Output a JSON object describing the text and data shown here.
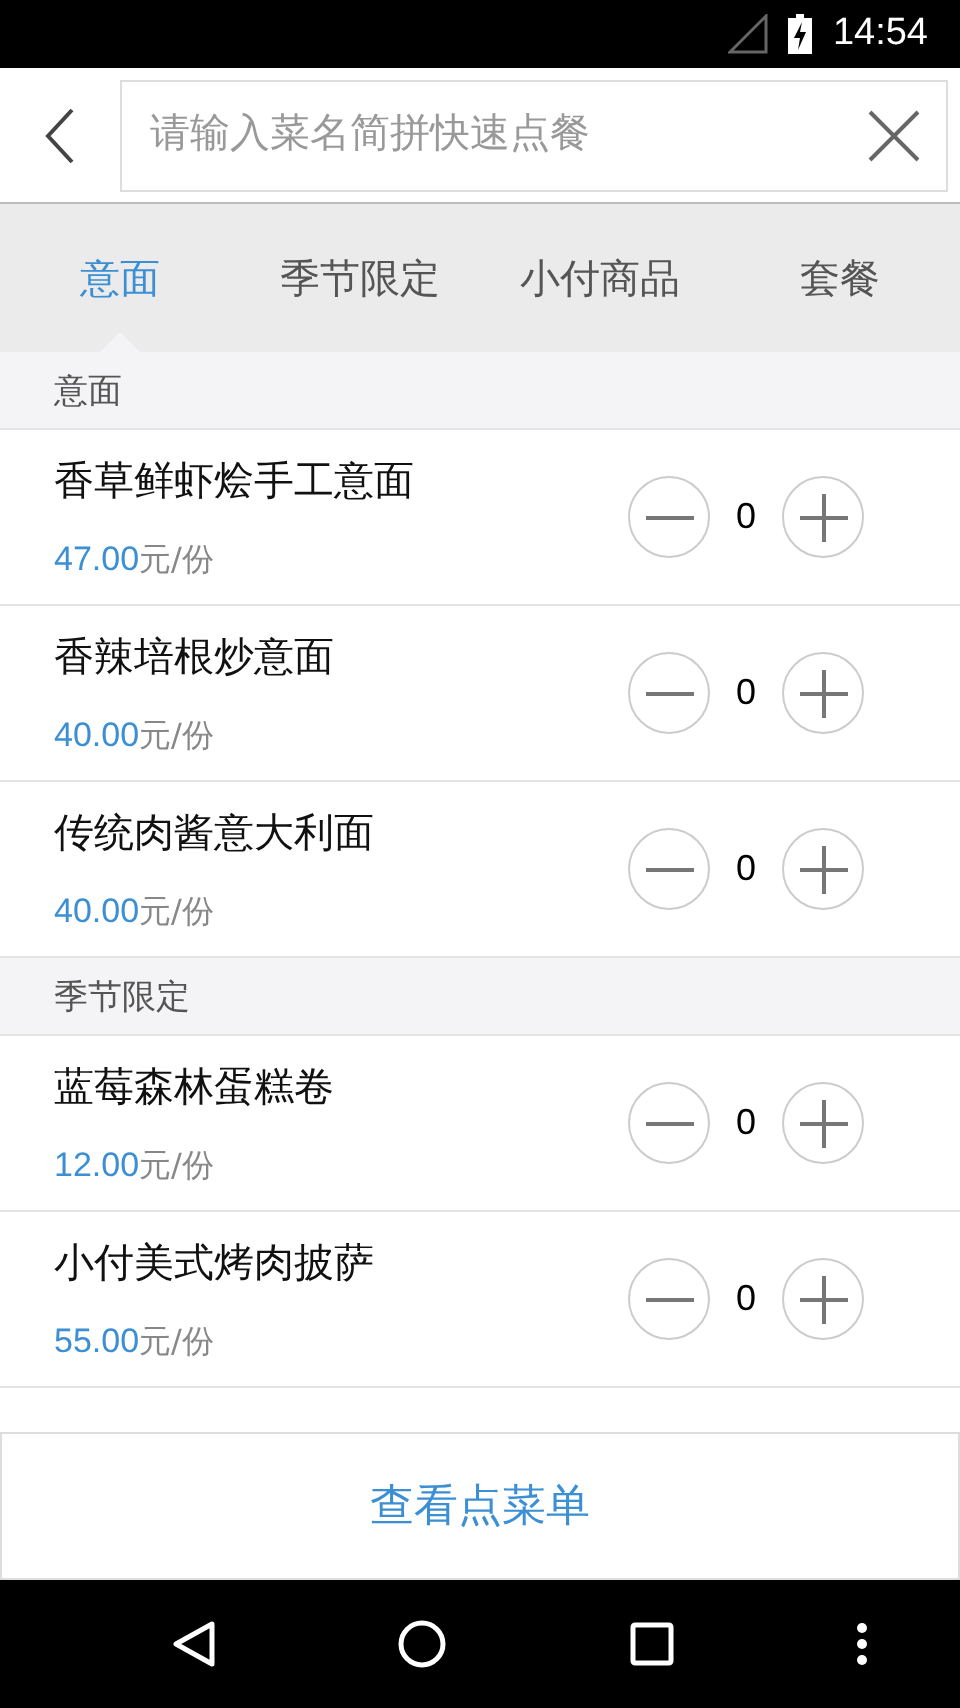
{
  "status_bar": {
    "time": "14:54"
  },
  "search": {
    "placeholder": "请输入菜名简拼快速点餐"
  },
  "tabs": [
    {
      "label": "意面",
      "selected": true
    },
    {
      "label": "季节限定",
      "selected": false
    },
    {
      "label": "小付商品",
      "selected": false
    },
    {
      "label": "套餐",
      "selected": false
    }
  ],
  "sections": [
    {
      "title": "意面",
      "items": [
        {
          "name": "香草鲜虾烩手工意面",
          "price": "47.00",
          "unit": "元/份",
          "count": "0"
        },
        {
          "name": "香辣培根炒意面",
          "price": "40.00",
          "unit": "元/份",
          "count": "0"
        },
        {
          "name": "传统肉酱意大利面",
          "price": "40.00",
          "unit": "元/份",
          "count": "0"
        }
      ]
    },
    {
      "title": "季节限定",
      "items": [
        {
          "name": "蓝莓森林蛋糕卷",
          "price": "12.00",
          "unit": "元/份",
          "count": "0"
        },
        {
          "name": "小付美式烤肉披萨",
          "price": "55.00",
          "unit": "元/份",
          "count": "0"
        }
      ]
    }
  ],
  "bottom_button": "查看点菜单"
}
